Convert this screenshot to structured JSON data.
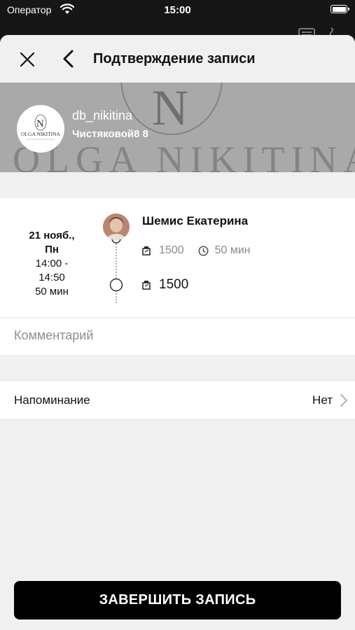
{
  "status_bar": {
    "carrier": "Оператор",
    "time": "15:00",
    "battery_level": 1.0
  },
  "nav": {
    "title": "Подтверждение записи"
  },
  "banner": {
    "watermark_initial": "N",
    "watermark_text": "OLGA NIKITINA",
    "logo_initial": "N",
    "logo_text": "OLGA NIKITINA",
    "studio_name": "db_nikitina",
    "address": "Чистяковой8 8"
  },
  "booking": {
    "date": "21 нояб.,",
    "weekday": "Пн",
    "time_range_start": "14:00 -",
    "time_range_end": "14:50",
    "duration": "50 мин",
    "master_name": "Шемис Екатерина",
    "service_price": "1500",
    "service_duration": "50 мин",
    "total_price": "1500"
  },
  "comment": {
    "placeholder": "Комментарий",
    "value": ""
  },
  "reminder": {
    "label": "Напоминание",
    "value": "Нет"
  },
  "cta": {
    "label": "ЗАВЕРШИТЬ ЗАПИСЬ"
  },
  "colors": {
    "banner": "#a9a9a9",
    "sheet": "#f0f0f0",
    "cta": "#000000",
    "muted_text": "#8a8a8a"
  },
  "icons": [
    "wifi-icon",
    "battery-icon",
    "close-icon",
    "back-chevron-icon",
    "service-icon",
    "clock-icon",
    "chevron-right-icon"
  ]
}
